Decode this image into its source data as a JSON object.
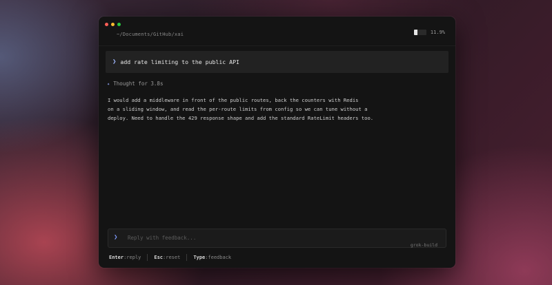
{
  "window": {
    "path": "~/Documents/GitHub/xai",
    "context_usage": {
      "label": "11.9%",
      "fraction": 0.119
    }
  },
  "prompt": {
    "chevron": "❯",
    "text": "add rate limiting to the public API"
  },
  "thought": {
    "icon": "spark-icon",
    "label": "Thought for 3.8s"
  },
  "response": {
    "lines": [
      "I would add a middleware in front of the public routes, back the counters with Redis",
      "on a sliding window, and read the per-route limits from config so we can tune without a",
      "deploy. Need to handle the 429 response shape and add the standard RateLimit headers too."
    ]
  },
  "input": {
    "chevron": "❯",
    "placeholder": "Reply with feedback...",
    "model": "grok-build"
  },
  "hints": [
    {
      "key": "Enter",
      "sep": ":",
      "action": "reply"
    },
    {
      "key": "Esc",
      "sep": ":",
      "action": "reset"
    },
    {
      "key": "Type",
      "sep": ":",
      "action": "feedback"
    }
  ],
  "colors": {
    "accent": "#8fa8ff",
    "background": "#141414"
  }
}
